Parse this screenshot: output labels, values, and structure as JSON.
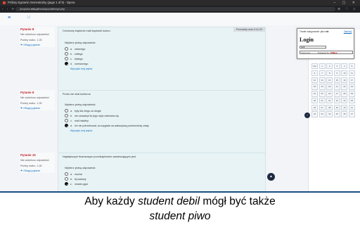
{
  "browser": {
    "window_title": "Próbny Egzamin Semestralny (page 1 of 9) - Opera",
    "url_prefix": "docplace.",
    "url_domain": "edu.pl",
    "url_path": "/mod/quiz/attempt.php"
  },
  "questions": [
    {
      "number_label": "Pytanie 8",
      "status": "Nie udzielono odpowiedzi",
      "points": "Punkty maks.: 1,00",
      "flag": "Oflaguj pytanie",
      "text": "Czerwony kapturek miał kapturek koloru:",
      "badge": "Pozostały czas 0:41:20",
      "answer_head": "Wybierz jedną odpowiedź:",
      "options": [
        {
          "letter": "a.",
          "label": "zielonego",
          "selected": false
        },
        {
          "letter": "b.",
          "label": "żółtego",
          "selected": false
        },
        {
          "letter": "c.",
          "label": "białego",
          "selected": false
        },
        {
          "letter": "d.",
          "label": "czerwonego",
          "selected": true
        }
      ],
      "clear": "Wyczyść mój wybór"
    },
    {
      "number_label": "Pytanie 9",
      "status": "Nie udzielono odpowiedzi",
      "points": "Punkty maks.: 1,00",
      "flag": "Oflaguj pytanie",
      "text": "Ponto nie miał kontorno",
      "badge": "",
      "answer_head": "Wybierz jedną odpowiedź:",
      "options": [
        {
          "letter": "a.",
          "label": "były dla niego za drogie",
          "selected": false
        },
        {
          "letter": "b.",
          "label": "nie zauważył że jego stylu ubierania się",
          "selected": false
        },
        {
          "letter": "c.",
          "label": "miał hakdiny",
          "selected": false
        },
        {
          "letter": "d.",
          "label": "ich nie potrzebował, za szyglata na wakacjową powierzchnię zdały",
          "selected": true
        }
      ],
      "clear": "Wyczyść mój wybór"
    },
    {
      "number_label": "Pytanie 10",
      "status": "Nie udzielono odpowiedzi",
      "points": "Punkty maks.: 1,00",
      "flag": "Oflaguj pytanie",
      "text": "Największym finansowym przedsiębiorem zawieszającym jest",
      "badge": "",
      "answer_head": "Wybierz jedną odpowiedź:",
      "options": [
        {
          "letter": "a.",
          "label": "mucha",
          "selected": false
        },
        {
          "letter": "b.",
          "label": "łój wołowy",
          "selected": false
        },
        {
          "letter": "c.",
          "label": "smalec gęsi",
          "selected": true
        }
      ],
      "clear": ""
    }
  ],
  "drawer": {
    "user": "Zalogowano jako",
    "user_name": "Próbny egzamin",
    "link": "Zakończ podejście ...",
    "nav_buttons": [
      "Info",
      "1",
      "2",
      "3",
      "4",
      "5",
      "6",
      "7",
      "8",
      "9",
      "10",
      "11",
      "12",
      "13",
      "14",
      "15",
      "16",
      "17",
      "18",
      "19",
      "20",
      "21",
      "22",
      "23",
      "24",
      "25",
      "26",
      "27",
      "28",
      "29",
      "30",
      "31",
      "32",
      "33",
      "34",
      "35",
      "36",
      "37",
      "38",
      "39",
      "40",
      "41",
      "42",
      "43",
      "44",
      "45",
      "46",
      "47"
    ]
  },
  "login": {
    "text": "Trwałe zalogowanie: jako",
    "count": "n/a",
    "action": "Zamknij",
    "title": "Login",
    "user_label": "Użyt",
    "user_value": "nick",
    "password_label": "Password",
    "password_hint": "Powered by",
    "logo_text": "SSBox"
  },
  "caption": {
    "line1_pre": "Aby każdy ",
    "line1_em": "student debil",
    "line1_post": " mógł być także",
    "line2_em": "student piwo"
  },
  "colors": {
    "accent": "#0f6cbf",
    "qcard_bg": "#e7f3f5",
    "question_number": "#c0262f",
    "scroll_button": "#1d2a3f"
  },
  "icons": [
    "menu-icon",
    "grid-icon",
    "scroll-up-icon",
    "drawer-close-icon",
    "radio-icon"
  ]
}
